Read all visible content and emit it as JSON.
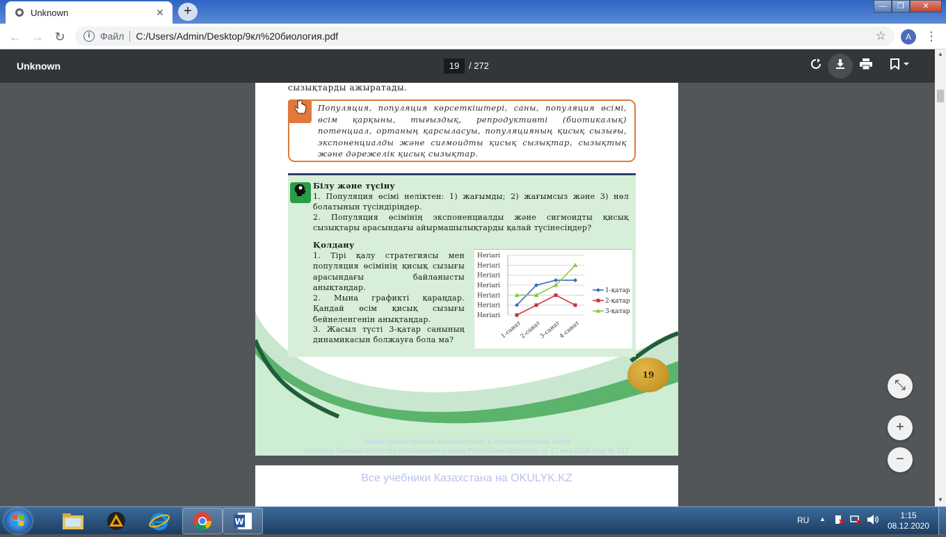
{
  "browser": {
    "tab_title": "Unknown",
    "tab_close": "✕",
    "new_tab": "+",
    "window_controls": {
      "minimize": "—",
      "maximize": "❐",
      "close": "✕"
    },
    "nav": {
      "back": "←",
      "forward": "→",
      "reload": "↻"
    },
    "omnibox": {
      "info": "i",
      "scheme": "Файл",
      "url": "C:/Users/Admin/Desktop/9кл%20биология.pdf",
      "star": "☆"
    },
    "avatar": "A",
    "menu": "⋮"
  },
  "pdf_toolbar": {
    "title": "Unknown",
    "page_current": "19",
    "page_total": "/ 272",
    "icons": [
      "rotate-icon",
      "download-icon",
      "print-icon",
      "bookmark-icon"
    ]
  },
  "page": {
    "intro": "сызықтарды ажыратады.",
    "key_terms": "Популяция, популяция көрсеткіштері, саны, популяция өсімі, өсім қарқыны, тығыздық, репродуктивті (биотикалық) потенциал, ортаның қарсыласуы, популяцияның қисық сызығы, экспоненциалды және сигмоидты қисық сызықтар, сызықтық және дәрежелік қисық сызықтар.",
    "section1_title": "Білу және түсіну",
    "section1_items": [
      "1. Популяция өсімі неліктен: 1) жағымды; 2) жағымсыз және 3) нөл болатынын түсіндіріңдер.",
      "2. Популяция өсімінің экспоненциалды және сигмоидты қисық сызықтары арасындағы айырмашылықтарды қалай түсінесіңдер?"
    ],
    "section2_title": "Қолдану",
    "section2_items": [
      "1. Тірі қалу стратегиясы мен популяция өсімінің қисық сызығы арасындағы байланысты анықтаңдар.",
      "2. Мына графикті қараңдар. Қандай өсім қисық сызығы бейнеленгенін анықтаңдар.",
      "3. Жасыл түсті 3-қатар санының динамикасын болжауға бола ма?"
    ],
    "page_number": "19",
    "footnote_line1": "*Книга предоставлена исключительно в образовательных целях",
    "footnote_line2": "согласно Приказа Министра образования и науки Республики Казахстан от 17 мая 2019 года № 217",
    "watermark": "Все учебники Казахстана на OKULYK.KZ"
  },
  "chart_data": {
    "type": "line",
    "categories": [
      "1-санат",
      "2-санат",
      "3-санат",
      "4-санат"
    ],
    "y_tick_labels": [
      "Heriarі",
      "Heriarі",
      "Heriarі",
      "Heriarі",
      "Heriarі",
      "Heriarі",
      "Heriarі"
    ],
    "ylim": [
      0,
      6
    ],
    "series": [
      {
        "name": "1-қатар",
        "color": "#2f6db5",
        "values": [
          1,
          3,
          3.5,
          3.5
        ]
      },
      {
        "name": "2-қатар",
        "color": "#c8333a",
        "values": [
          0,
          1,
          2,
          1
        ]
      },
      {
        "name": "3-қатар",
        "color": "#8dc63f",
        "values": [
          2,
          2,
          3,
          5
        ]
      }
    ]
  },
  "zoom_controls": {
    "fit": "⤡",
    "zoom_in": "+",
    "zoom_out": "−"
  },
  "taskbar": {
    "language": "RU",
    "time": "1:15",
    "date": "08.12.2020"
  }
}
